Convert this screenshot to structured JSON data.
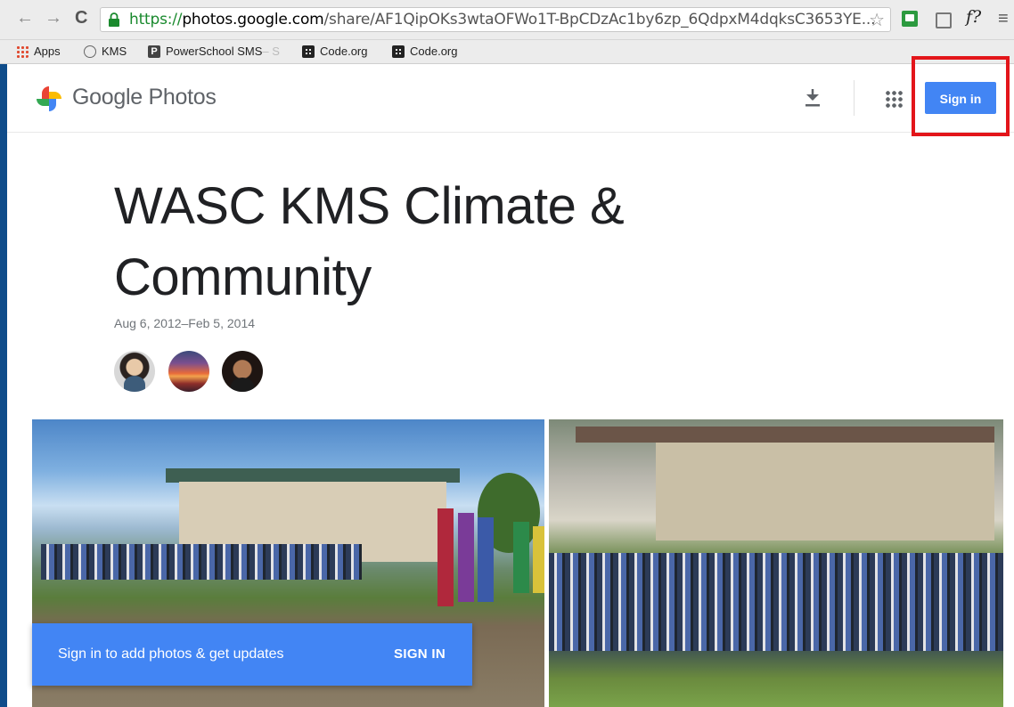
{
  "browser": {
    "url_scheme": "https://",
    "url_host": "photos.google.com",
    "url_path": "/share/AF1QipOKs3wtaOFWo1T-BpCDzAc1by6zp_6QdpxM4dqksC3653YE...",
    "ext_f_label": "f?"
  },
  "bookmarks": [
    {
      "label": "Apps",
      "icon": "apps-grid-icon"
    },
    {
      "label": "KMS",
      "icon": "kms-icon"
    },
    {
      "label": "PowerSchool SMS",
      "suffix": " – S",
      "icon": "powerschool-icon"
    },
    {
      "label": "Code.org",
      "icon": "code-org-icon"
    },
    {
      "label": "Code.org",
      "icon": "code-org-icon"
    }
  ],
  "header": {
    "brand_google": "Google",
    "brand_product": "Photos",
    "signin_label": "Sign in"
  },
  "album": {
    "title": "WASC KMS Climate & Community",
    "date_range": "Aug 6, 2012–Feb 5, 2014"
  },
  "banner": {
    "text": "Sign in to add photos & get updates",
    "button_label": "SIGN IN"
  },
  "colors": {
    "accent_blue": "#4285f4",
    "highlight_red": "#e3151a",
    "secure_green": "#1a8a2e"
  }
}
